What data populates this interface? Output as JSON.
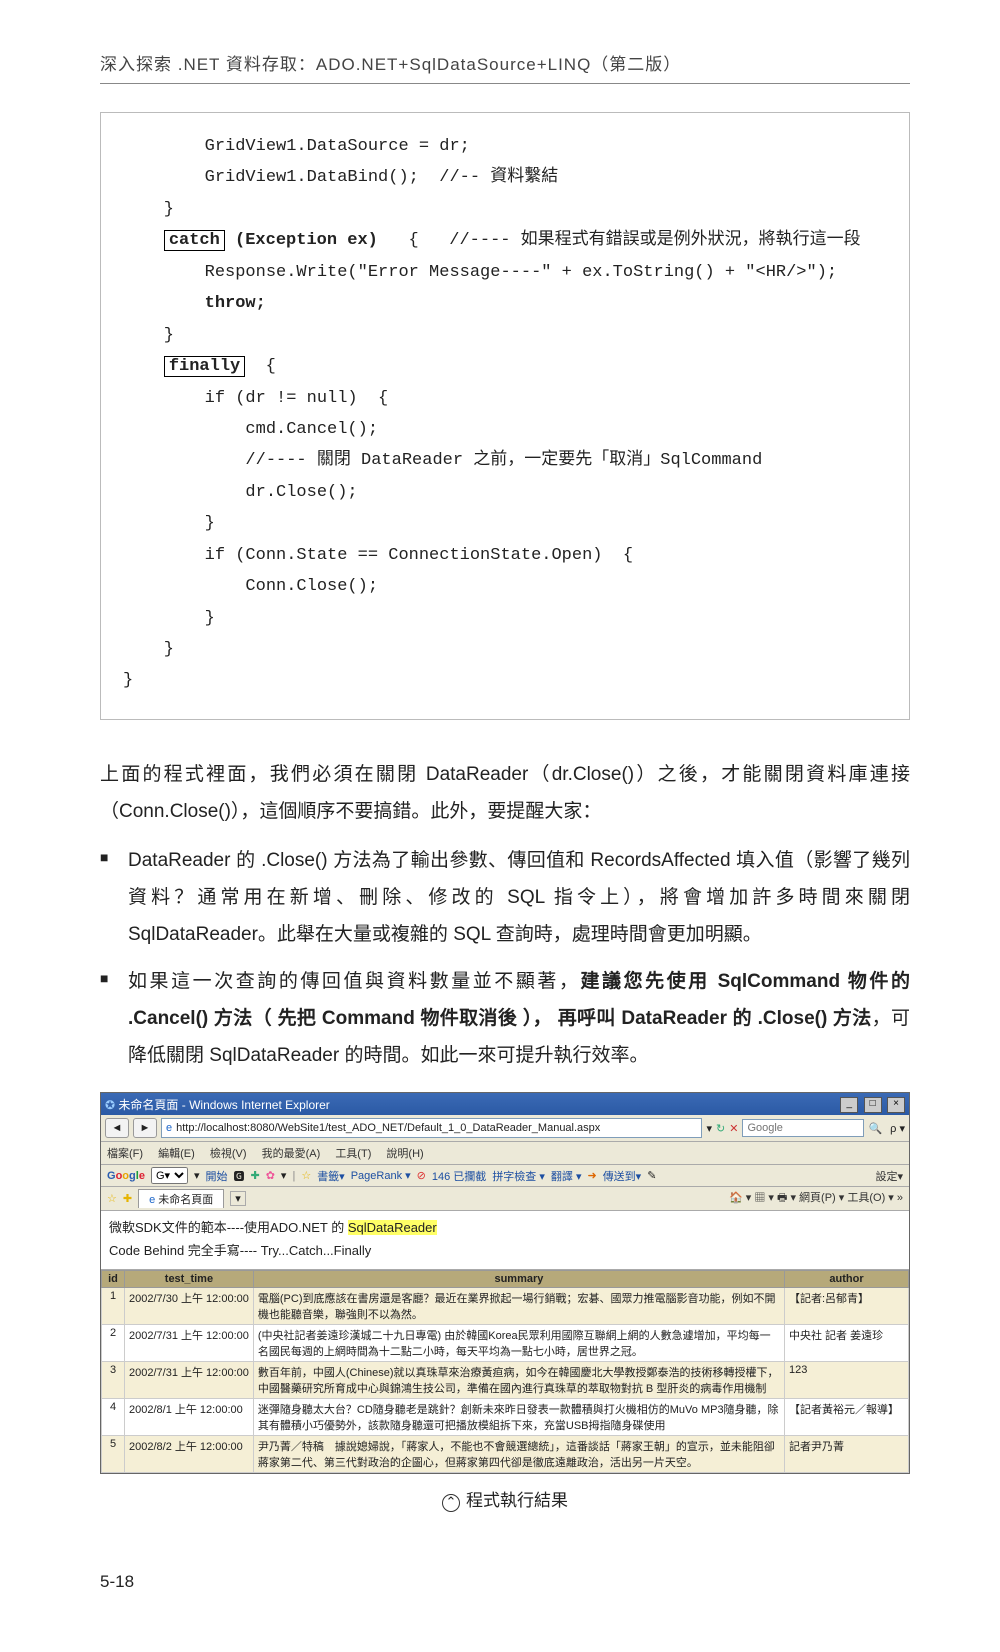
{
  "header": {
    "title": "深入探索 .NET 資料存取：ADO.NET+SqlDataSource+LINQ（第二版）"
  },
  "code": {
    "l1": "        GridView1.DataSource = dr;",
    "l2": "        GridView1.DataBind();  //-- 資料繫結",
    "l3": "    }",
    "l4a": "    ",
    "l4b": "catch",
    "l4c": " (Exception ex)",
    "l4d": "   {   //---- 如果程式有錯誤或是例外狀況，將執行這一段",
    "l5": "        Response.Write(\"Error Message----\" + ex.ToString() + \"<HR/>\");",
    "l6": "        throw;",
    "l7": "    }",
    "l8a": "    ",
    "l8b": "finally",
    "l8c": "  {",
    "l9": "        if (dr != null)  {",
    "l10": "            cmd.Cancel();",
    "l11": "            //---- 關閉 DataReader 之前，一定要先「取消」SqlCommand",
    "l12": "            dr.Close();",
    "l13": "        }",
    "l14": "        if (Conn.State == ConnectionState.Open)  {",
    "l15": "            Conn.Close();",
    "l16": "        }",
    "l17": "    }",
    "l18": "}"
  },
  "paragraph1": "上面的程式裡面，我們必須在關閉 DataReader（dr.Close()）之後，才能關閉資料庫連接（Conn.Close()），這個順序不要搞錯。此外，要提醒大家：",
  "bullets": [
    {
      "text": "DataReader 的 .Close() 方法為了輸出參數、傳回值和 RecordsAffected 填入值（影響了幾列資料？通常用在新增、刪除、修改的 SQL 指令上），將會增加許多時間來關閉 SqlDataReader。此舉在大量或複雜的 SQL 查詢時，處理時間會更加明顯。"
    },
    {
      "pre": "如果這一次查詢的傳回值與資料數量並不顯著，",
      "bold": "建議您先使用 SqlCommand 物件的 .Cancel() 方法（ 先把 Command 物件取消後 ）， 再呼叫 DataReader 的 .Close() 方法",
      "post": "，可降低關閉 SqlDataReader 的時間。如此一來可提升執行效率。"
    }
  ],
  "ie": {
    "title": "未命名頁面 - Windows Internet Explorer",
    "url": "http://localhost:8080/WebSite1/test_ADO_NET/Default_1_0_DataReader_Manual.aspx",
    "searchPlaceholder": "Google",
    "menus": [
      "檔案(F)",
      "編輯(E)",
      "檢視(V)",
      "我的最愛(A)",
      "工具(T)",
      "說明(H)"
    ],
    "google": {
      "start": "開始",
      "items": [
        "書籤▾",
        "PageRank ▾",
        "146 已攔截",
        "拼字檢查 ▾",
        "翻譯 ▾",
        "傳送到▾"
      ],
      "right": "設定▾"
    },
    "tab": "未命名頁面",
    "tabRight": "網頁(P) ▾  工具(O) ▾",
    "content_line1_pre": "微軟SDK文件的範本----使用ADO.NET 的 ",
    "content_line1_hl": "SqlDataReader",
    "content_line2": "Code Behind 完全手寫---- Try...Catch...Finally",
    "table": {
      "headers": [
        "id",
        "test_time",
        "summary",
        "author"
      ],
      "rows": [
        {
          "id": "1",
          "ts": "2002/7/30 上午 12:00:00",
          "summary": "電腦(PC)到底應該在書房還是客廳？最近在業界掀起一場行銷戰；宏碁、國眾力推電腦影音功能，例如不開機也能聽音樂，聯強則不以為然。",
          "author": "【記者:呂郁青】"
        },
        {
          "id": "2",
          "ts": "2002/7/31 上午 12:00:00",
          "summary": "(中央社記者姜遠珍漢城二十九日專電) 由於韓國Korea民眾利用國際互聯網上網的人數急遽增加，平均每一名國民每週的上網時間為十二點二小時，每天平均為一點七小時，居世界之冠。",
          "author": "中央社 記者 姜遠珍"
        },
        {
          "id": "3",
          "ts": "2002/7/31 上午 12:00:00",
          "summary": "數百年前，中國人(Chinese)就以真珠草來治療黃疸病，如今在韓國慶北大學教授鄭泰浩的技術移轉授權下，中國醫藥研究所育成中心與錦鴻生技公司，準備在國內進行真珠草的萃取物對抗 B 型肝炎的病毒作用機制",
          "author": "123"
        },
        {
          "id": "4",
          "ts": "2002/8/1 上午 12:00:00",
          "summary": "迷彈隨身聽太大台？CD隨身聽老是跳針？創新未來昨日發表一款體積與打火機相仿的MuVo MP3隨身聽，除其有體積小巧優勢外，該款隨身聽還可把播放模組拆下來，充當USB拇指隨身碟使用",
          "author": "【記者黃裕元／報導】"
        },
        {
          "id": "5",
          "ts": "2002/8/2 上午 12:00:00",
          "summary": "尹乃菁／特稿　據說媳婦說，「蔣家人，不能也不會競選總統」，這番談話「蔣家王朝」的宣示，並未能阻卻蔣家第二代、第三代對政治的企圖心，但蔣家第四代卻是徹底遠離政治，活出另一片天空。",
          "author": "記者尹乃菁"
        }
      ]
    }
  },
  "caption": "程式執行結果",
  "page_number": "5-18"
}
